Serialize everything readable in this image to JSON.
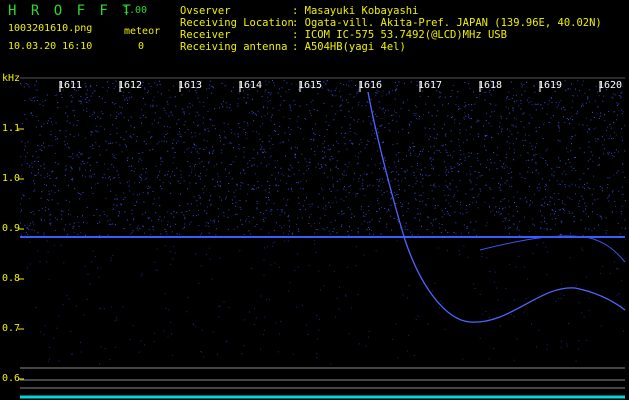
{
  "app": {
    "name": "H R O F F T",
    "version": "1.00",
    "filename": "1003201610.png",
    "datetime": "10.03.20 16:10",
    "meteor_label": "meteor",
    "meteor_count": "0"
  },
  "info": {
    "rows": [
      {
        "label": "Ovserver",
        "value": ": Masayuki Kobayashi"
      },
      {
        "label": "Receiving Location",
        "value": ": Ogata-vill. Akita-Pref. JAPAN (139.96E, 40.02N)"
      },
      {
        "label": "Receiver",
        "value": ": ICOM IC-575 53.7492(@LCD)MHz USB"
      },
      {
        "label": "Receiving antenna",
        "value": ": A504HB(yagi 4el)"
      }
    ]
  },
  "spectrogram": {
    "unit_label": "kHz",
    "time_ticks": [
      "1611",
      "1612",
      "1613",
      "1614",
      "1615",
      "1616",
      "1617",
      "1618",
      "1619",
      "1620"
    ],
    "freq_ticks": [
      "1.1",
      "1.0",
      "0.9",
      "0.8",
      "0.7",
      "0.6"
    ],
    "colors": {
      "background": "#000000",
      "noise": "#2a3cff",
      "line": "#4060ff",
      "ticks": "#ffffff",
      "axis": "#f0f000",
      "bottom": "#00e5e5"
    }
  }
}
